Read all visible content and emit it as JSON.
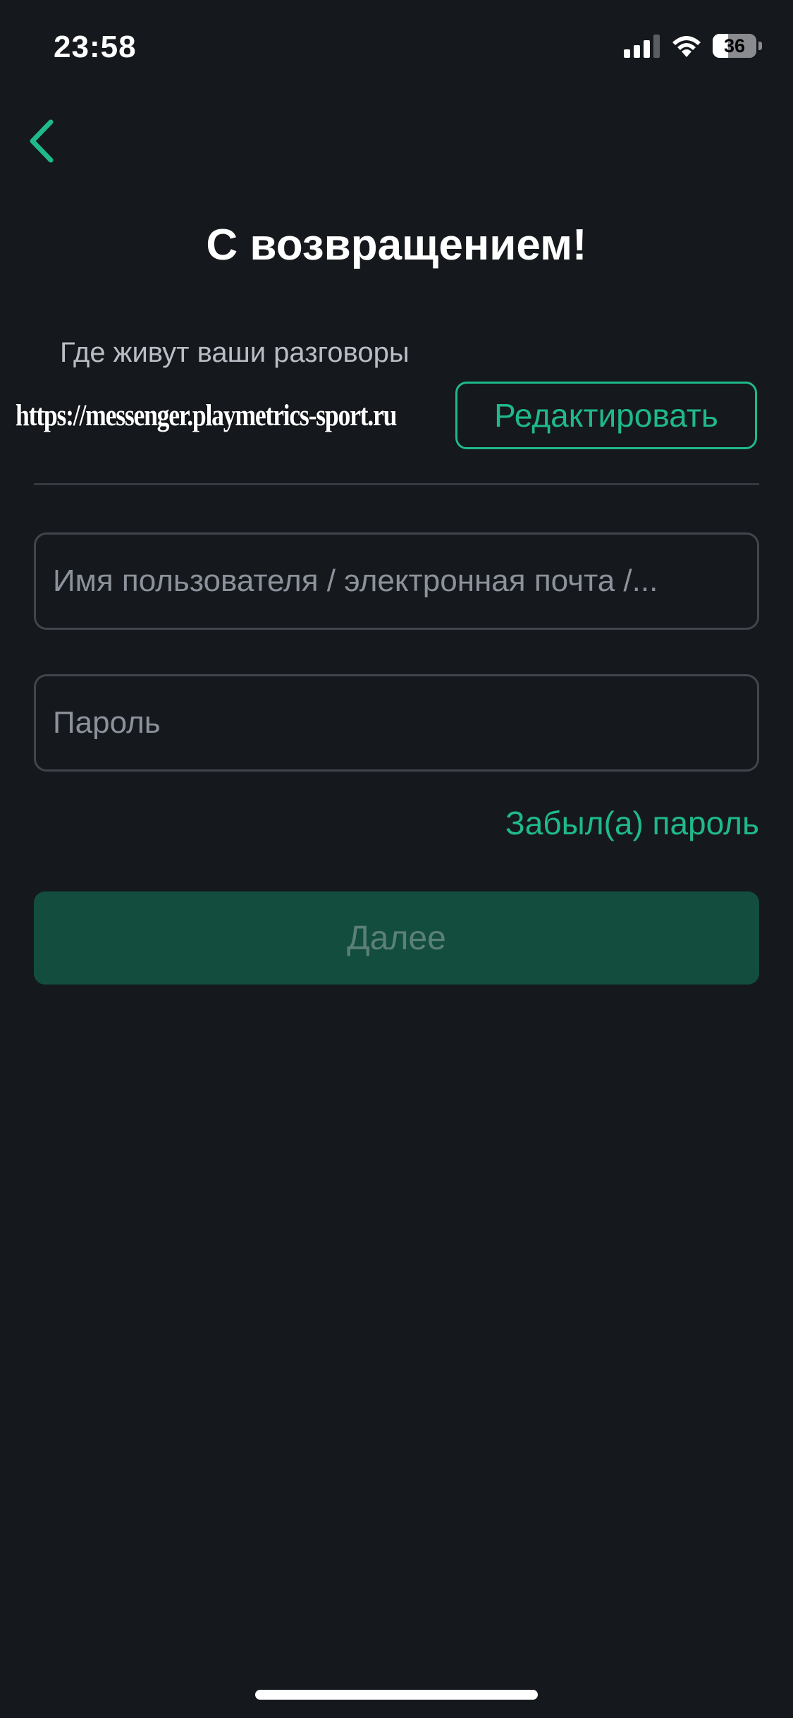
{
  "status_bar": {
    "time": "23:58",
    "battery_level": "36",
    "battery_fraction": 0.36,
    "signal_bars_active": 3,
    "signal_bars_total": 4,
    "icons": [
      "signal-icon",
      "wifi-icon",
      "battery-icon"
    ]
  },
  "header": {
    "back_icon": "chevron-left-icon",
    "title": "С возвращением!"
  },
  "server": {
    "caption": "Где живут ваши разговоры",
    "url": "https://messenger.playmetrics-sport.ru",
    "edit_label": "Редактировать"
  },
  "form": {
    "username_placeholder": "Имя пользователя / электронная почта /...",
    "username_value": "",
    "password_placeholder": "Пароль",
    "password_value": "",
    "forgot_password_label": "Забыл(а) пароль",
    "submit_label": "Далее",
    "submit_enabled": false
  },
  "colors": {
    "background": "#15181d",
    "accent": "#1fb98a",
    "button_disabled_bg": "#134d3e",
    "button_disabled_text": "#5c8076",
    "field_border": "#41464e",
    "placeholder": "#8c929b"
  }
}
